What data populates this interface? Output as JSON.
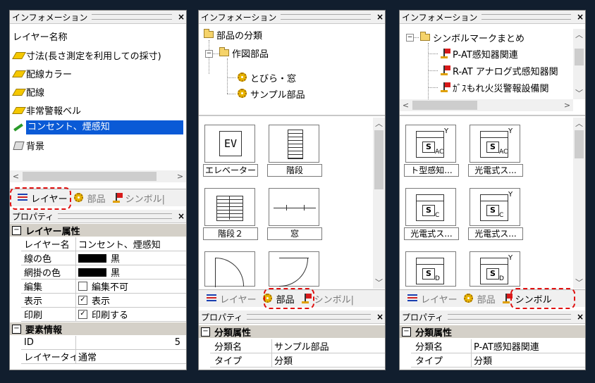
{
  "common": {
    "info_title": "インフォメーション",
    "prop_title": "プロパティ",
    "close": "×",
    "tab_layer": "レイヤー",
    "tab_parts": "部品",
    "tab_symbol": "シンボル",
    "highlight_color": "#e01010",
    "selection_color": "#0a5ad6"
  },
  "panel1": {
    "list_header": "レイヤー名称",
    "layers": [
      {
        "label": "寸法(長さ測定を利用しての採寸)",
        "icon": "diamond-icon"
      },
      {
        "label": "配線カラー",
        "icon": "diamond-icon"
      },
      {
        "label": "配線",
        "icon": "diamond-icon"
      },
      {
        "label": "非常警報ベル",
        "icon": "diamond-icon"
      },
      {
        "label": "コンセント、煙感知",
        "icon": "pencil-icon",
        "selected": true
      },
      {
        "label": "背景",
        "icon": "background-icon"
      }
    ],
    "tab_selected": "レイヤー",
    "tab_symbol": "シンボル|",
    "props": {
      "group1": "レイヤー属性",
      "rows": [
        {
          "k": "レイヤー名",
          "v": "コンセント、煙感知"
        },
        {
          "k": "線の色",
          "v": "黒"
        },
        {
          "k": "網掛の色",
          "v": "黒"
        },
        {
          "k": "編集",
          "v": "編集不可",
          "checked": false
        },
        {
          "k": "表示",
          "v": "表示",
          "checked": true
        },
        {
          "k": "印刷",
          "v": "印刷する",
          "checked": true
        }
      ],
      "group2": "要素情報",
      "rows2": [
        {
          "k": "ID",
          "v": "5"
        },
        {
          "k": "レイヤータイプ",
          "v": "通常"
        }
      ]
    }
  },
  "panel2": {
    "tree": [
      {
        "label": "部品の分類",
        "icon": "folder-icon"
      },
      {
        "label": "作図部品",
        "icon": "folder-icon"
      },
      {
        "label": "とびら・窓",
        "icon": "gear-icon"
      },
      {
        "label": "サンプル部品",
        "icon": "gear-icon",
        "selected": true
      }
    ],
    "parts": [
      {
        "label": "エレベーター",
        "symbol": "EV"
      },
      {
        "label": "階段",
        "symbol": "stairs"
      },
      {
        "label": "階段２",
        "symbol": "stairs2"
      },
      {
        "label": "窓",
        "symbol": "window"
      }
    ],
    "tab_layer": "レイヤー",
    "tab_selected": "部品",
    "tab_symbol": "シンボル|",
    "props": {
      "group1": "分類属性",
      "rows": [
        {
          "k": "分類名",
          "v": "サンプル部品"
        },
        {
          "k": "タイプ",
          "v": "分類"
        }
      ]
    }
  },
  "panel3": {
    "tree": [
      {
        "label": "シンボルマークまとめ",
        "icon": "folder-icon"
      },
      {
        "label": "P-AT感知器関連",
        "icon": "flag-icon"
      },
      {
        "label": "R-AT アナログ式感知器関",
        "icon": "flag-icon"
      },
      {
        "label": "ｶﾞｽもれ火災警報設備関",
        "icon": "flag-icon"
      }
    ],
    "symbols": [
      {
        "label": "ト型感知...",
        "marks": [
          "Y",
          "S",
          "AC"
        ]
      },
      {
        "label": "光電式ス...",
        "marks": [
          "Y",
          "S",
          "AC"
        ]
      },
      {
        "label": "光電式ス...",
        "marks": [
          "",
          "S",
          "C"
        ]
      },
      {
        "label": "光電式ス...",
        "marks": [
          "Y",
          "S",
          "C"
        ]
      },
      {
        "label": "",
        "marks": [
          "",
          "S",
          "D"
        ]
      },
      {
        "label": "",
        "marks": [
          "Y",
          "S",
          "D"
        ]
      }
    ],
    "tab_layer": "レイヤー",
    "tab_parts": "部品",
    "tab_selected": "シンボル",
    "props": {
      "group1": "分類属性",
      "rows": [
        {
          "k": "分類名",
          "v": "P-AT感知器関連"
        },
        {
          "k": "タイプ",
          "v": "分類"
        }
      ]
    }
  }
}
